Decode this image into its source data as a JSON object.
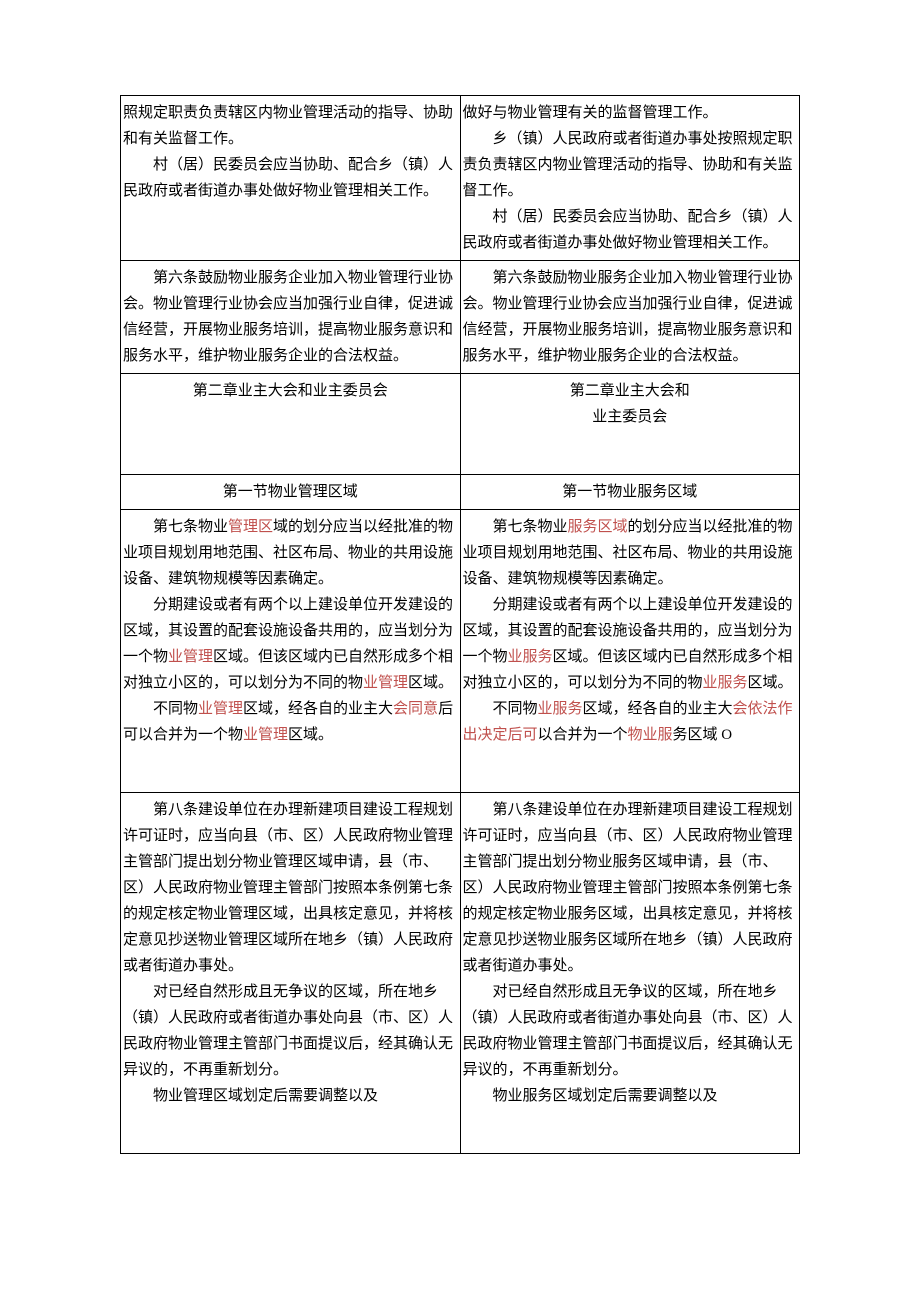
{
  "rows": [
    {
      "left": [
        {
          "indent": false,
          "runs": [
            {
              "t": "照规定职责负责辖区内物业管理活动的指导、协助和有关监督工作。"
            }
          ]
        },
        {
          "indent": true,
          "runs": [
            {
              "t": "村（居）民委员会应当协助、配合乡（镇）人民政府或者街道办事处做好物业管理相关工作。"
            }
          ]
        }
      ],
      "right": [
        {
          "indent": false,
          "runs": [
            {
              "t": "做好与物业管理有关的监督管理工作。"
            }
          ]
        },
        {
          "indent": true,
          "runs": [
            {
              "t": "乡（镇）人民政府或者街道办事处按照规定职责负责辖区内物业管理活动的指导、协助和有关监督工作。"
            }
          ]
        },
        {
          "indent": true,
          "runs": [
            {
              "t": "村（居）民委员会应当协助、配合乡（镇）人民政府或者街道办事处做好物业管理相关工作。"
            }
          ]
        }
      ]
    },
    {
      "left": [
        {
          "indent": true,
          "runs": [
            {
              "t": "第六条鼓励物业服务企业加入物业管理行业协会。物业管理行业协会应当加强行业自律，促进诚信经营，开展物业服务培训，提高物业服务意识和服务水平，维护物业服务企业的合法权益。"
            }
          ]
        }
      ],
      "right": [
        {
          "indent": true,
          "runs": [
            {
              "t": "第六条鼓励物业服务企业加入物业管理行业协会。物业管理行业协会应当加强行业自律，促进诚信经营，开展物业服务培训，提高物业服务意识和服务水平，维护物业服务企业的合法权益。"
            }
          ]
        }
      ]
    },
    {
      "chapter": true,
      "left": [
        {
          "center": true,
          "runs": [
            {
              "t": "第二章业主大会和业主委员会"
            }
          ]
        }
      ],
      "right": [
        {
          "center": true,
          "runs": [
            {
              "t": "第二章业主大会和"
            }
          ]
        },
        {
          "center": true,
          "runs": [
            {
              "t": "业主委员会"
            }
          ]
        }
      ],
      "padBottom": true
    },
    {
      "section": true,
      "left": [
        {
          "center": true,
          "runs": [
            {
              "t": "第一节物业管理区域"
            }
          ]
        }
      ],
      "right": [
        {
          "center": true,
          "runs": [
            {
              "t": "第一节物业服务区域"
            }
          ]
        }
      ]
    },
    {
      "left": [
        {
          "indent": true,
          "runs": [
            {
              "t": "第七条物业"
            },
            {
              "t": "管理区",
              "mark": true
            },
            {
              "t": "域的划分应当以经批准的物业项目规划用地范围、社区布局、物业的共用设施设备、建筑物规模等因素确定。"
            }
          ]
        },
        {
          "indent": true,
          "runs": [
            {
              "t": "分期建设或者有两个以上建设单位开发建设的区域，其设置的配套设施设备共用的，应当划分为一个物"
            },
            {
              "t": "业管理",
              "mark": true
            },
            {
              "t": "区域。但该区域内已自然形成多个相对独立小区的，可以划分为不同的物"
            },
            {
              "t": "业管理",
              "mark": true
            },
            {
              "t": "区域。"
            }
          ]
        },
        {
          "indent": true,
          "runs": [
            {
              "t": "不同物"
            },
            {
              "t": "业管理",
              "mark": true
            },
            {
              "t": "区域，经各自的业主大"
            },
            {
              "t": "会同意",
              "mark": true
            },
            {
              "t": "后可以合并为一个物"
            },
            {
              "t": "业管理",
              "mark": true
            },
            {
              "t": "区域。"
            }
          ]
        }
      ],
      "right": [
        {
          "indent": true,
          "runs": [
            {
              "t": "第七条物业"
            },
            {
              "t": "服务区域",
              "mark": true
            },
            {
              "t": "的划分应当以经批准的物业项目规划用地范围、社区布局、物业的共用设施设备、建筑物规模等因素确定。"
            }
          ]
        },
        {
          "indent": true,
          "runs": [
            {
              "t": "分期建设或者有两个以上建设单位开发建设的区域，其设置的配套设施设备共用的，应当划分为一个物"
            },
            {
              "t": "业服务",
              "mark": true
            },
            {
              "t": "区域。但该区域内已自然形成多个相对独立小区的，可以划分为不同的物"
            },
            {
              "t": "业服务",
              "mark": true
            },
            {
              "t": "区域。"
            }
          ]
        },
        {
          "indent": true,
          "runs": [
            {
              "t": "不同物"
            },
            {
              "t": "业服务",
              "mark": true
            },
            {
              "t": "区域，经各自的业主大"
            },
            {
              "t": "会依法作出决定后可",
              "mark": true
            },
            {
              "t": "以合并为一个"
            },
            {
              "t": "物业服",
              "mark": true
            },
            {
              "t": "务区域 O"
            }
          ]
        }
      ],
      "padBottom": true
    },
    {
      "left": [
        {
          "indent": true,
          "runs": [
            {
              "t": "第八条建设单位在办理新建项目建设工程规划许可证时，应当向县（市、区）人民政府物业管理主管部门提出划分物业管理区域申请，县（市、区）人民政府物业管理主管部门按照本条例第七条的规定核定物业管理区域，出具核定意见，并将核定意见抄送物业管理区域所在地乡（镇）人民政府或者街道办事处。"
            }
          ]
        },
        {
          "indent": true,
          "runs": [
            {
              "t": "对已经自然形成且无争议的区域，所在地乡（镇）人民政府或者街道办事处向县（市、区）人民政府物业管理主管部门书面提议后，经其确认无异议的，不再重新划分。"
            }
          ]
        },
        {
          "indent": true,
          "runs": [
            {
              "t": "物业管理区域划定后需要调整以及"
            }
          ]
        }
      ],
      "right": [
        {
          "indent": true,
          "runs": [
            {
              "t": "第八条建设单位在办理新建项目建设工程规划许可证时，应当向县（市、区）人民政府物业管理主管部门提出划分物业服务区域申请，县（市、区）人民政府物业管理主管部门按照本条例第七条的规定核定物业服务区域，出具核定意见，并将核定意见抄送物业服务区域所在地乡（镇）人民政府或者街道办事处。"
            }
          ]
        },
        {
          "indent": true,
          "runs": [
            {
              "t": "对已经自然形成且无争议的区域，所在地乡（镇）人民政府或者街道办事处向县（市、区）人民政府物业管理主管部门书面提议后，经其确认无异议的，不再重新划分。"
            }
          ]
        },
        {
          "indent": true,
          "runs": [
            {
              "t": "物业服务区域划定后需要调整以及"
            }
          ]
        }
      ],
      "padBottom": true
    }
  ]
}
